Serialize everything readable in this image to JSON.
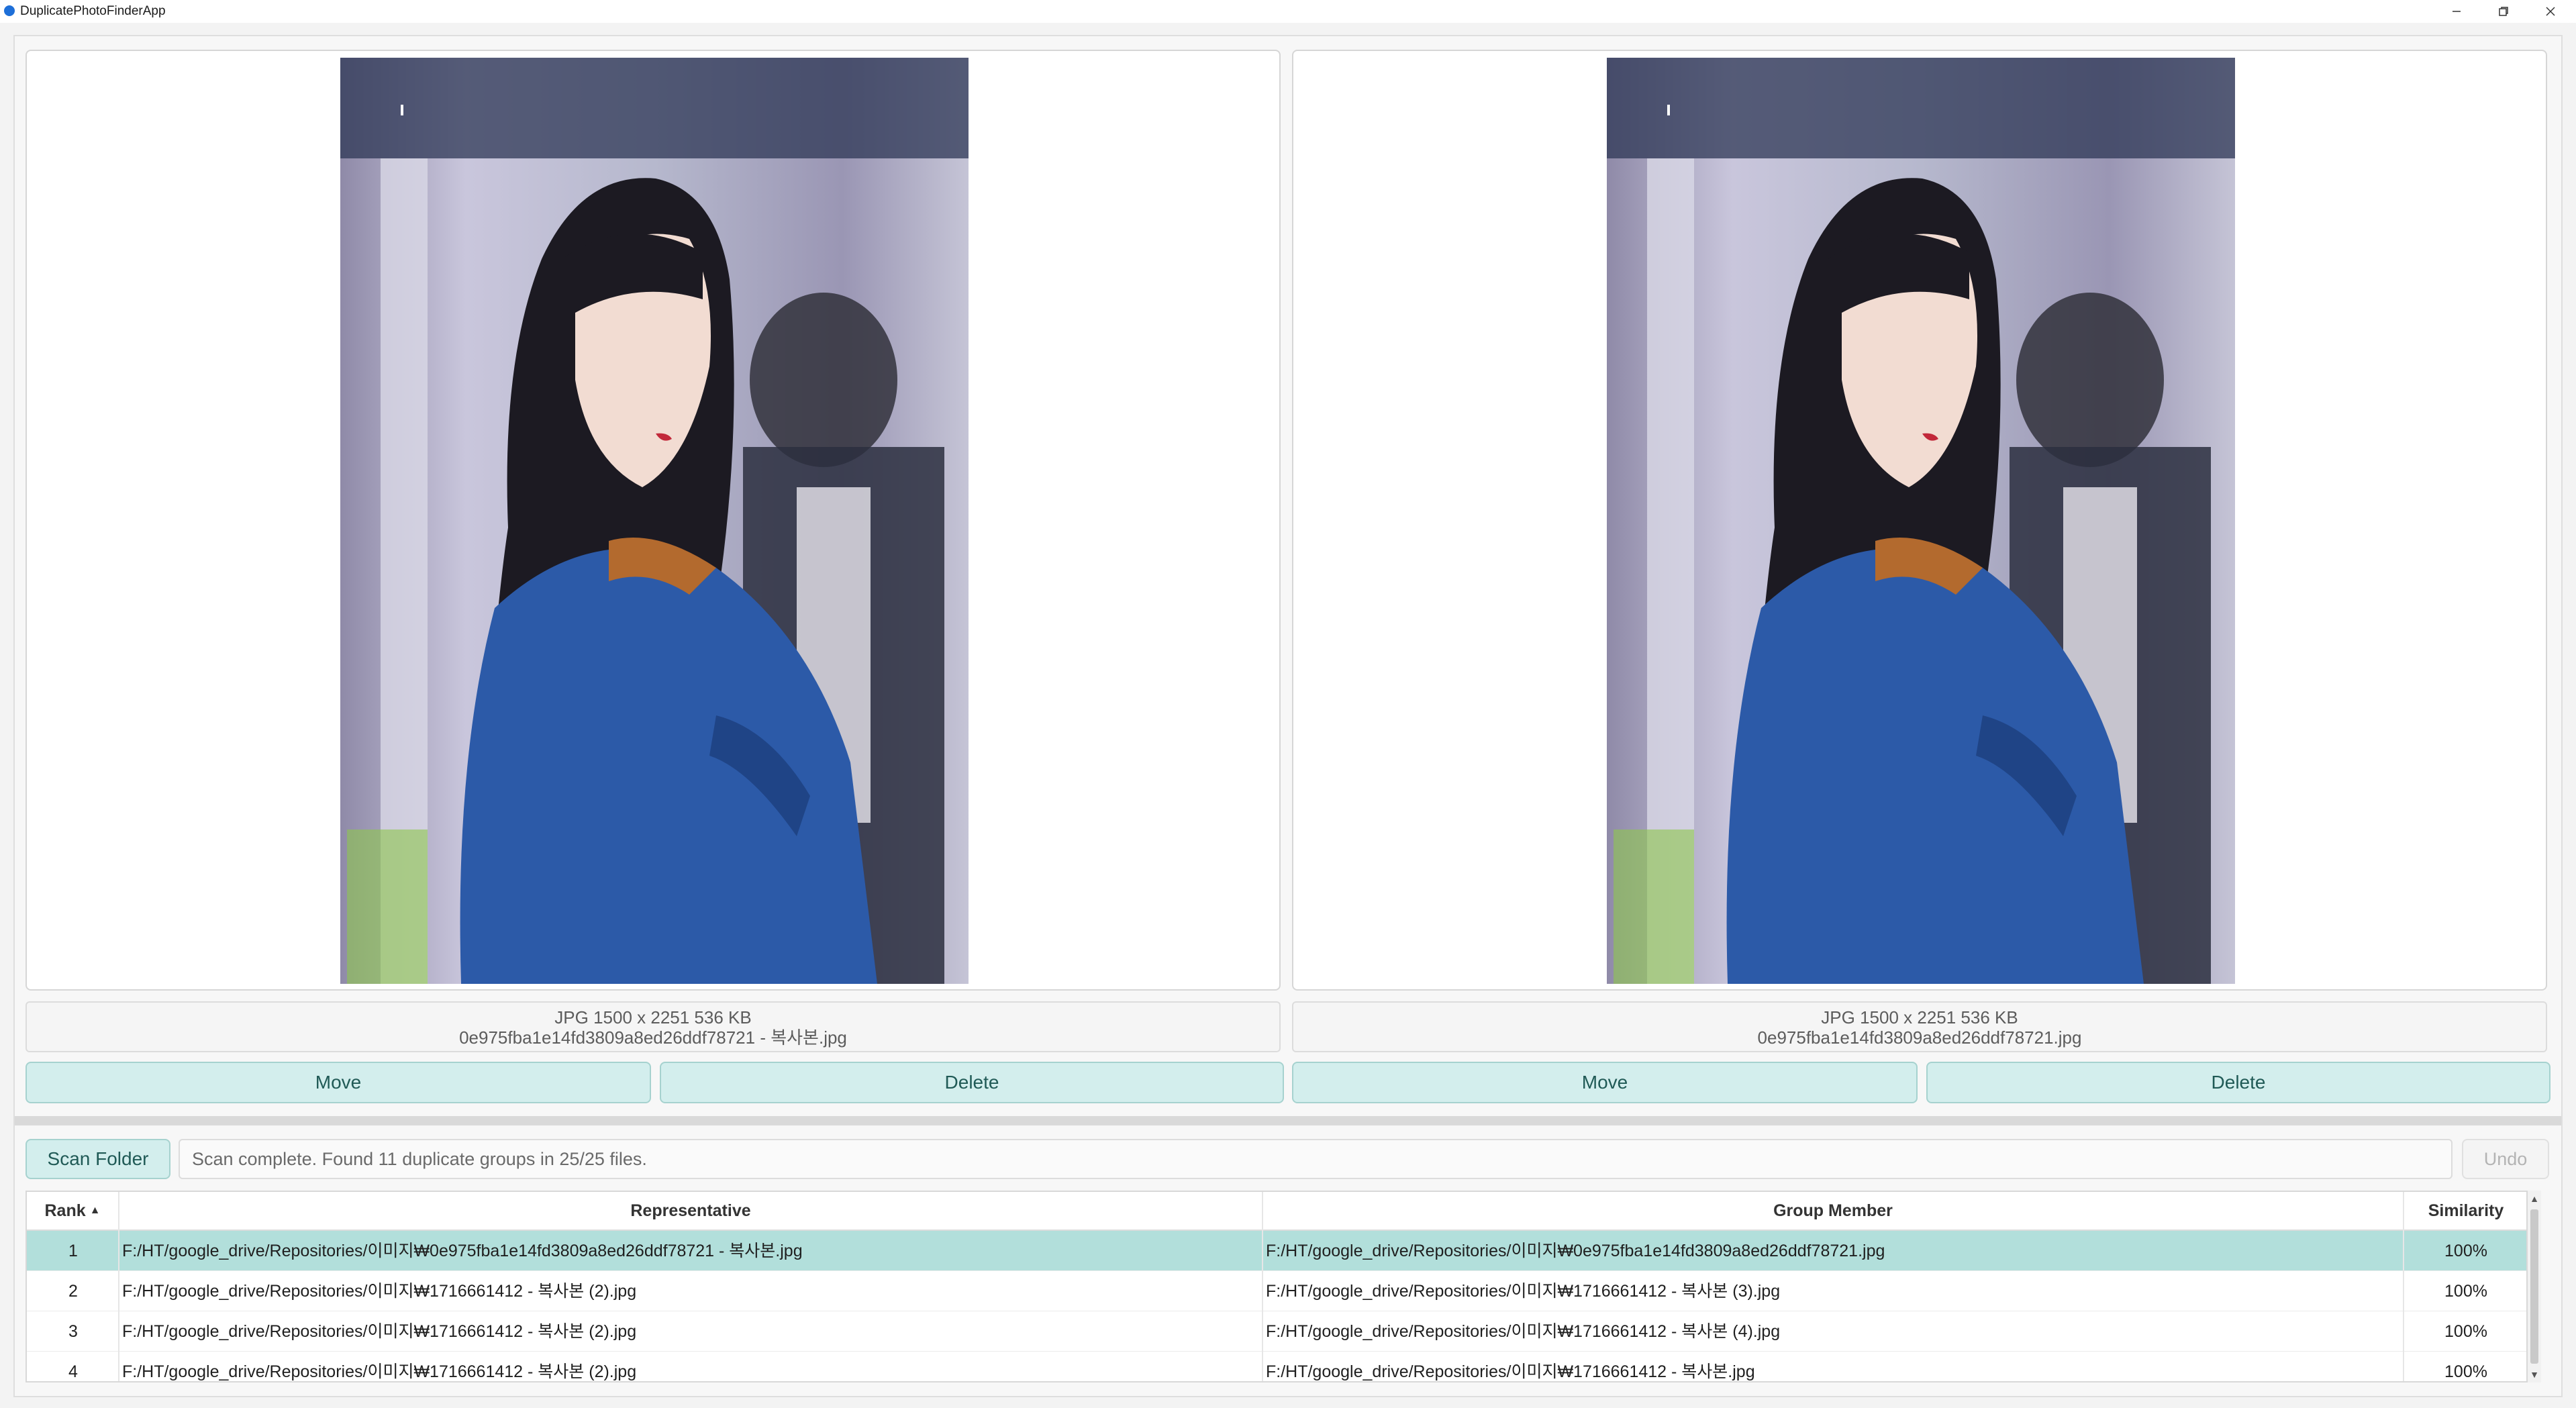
{
  "window": {
    "title": "DuplicatePhotoFinderApp"
  },
  "left": {
    "info_line1": "JPG 1500 x 2251 536 KB",
    "info_line2": "0e975fba1e14fd3809a8ed26ddf78721 - 복사본.jpg",
    "move_label": "Move",
    "delete_label": "Delete"
  },
  "right": {
    "info_line1": "JPG 1500 x 2251 536 KB",
    "info_line2": "0e975fba1e14fd3809a8ed26ddf78721.jpg",
    "move_label": "Move",
    "delete_label": "Delete"
  },
  "toolbar": {
    "scan_label": "Scan Folder",
    "status": "Scan complete. Found 11 duplicate groups in 25/25 files.",
    "undo_label": "Undo"
  },
  "table": {
    "headers": {
      "rank": "Rank",
      "representative": "Representative",
      "member": "Group Member",
      "similarity": "Similarity"
    },
    "sort_indicator": "▲",
    "rows": [
      {
        "rank": "1",
        "representative": "F:/HT/google_drive/Repositories/이미지₩0e975fba1e14fd3809a8ed26ddf78721 - 복사본.jpg",
        "member": "F:/HT/google_drive/Repositories/이미지₩0e975fba1e14fd3809a8ed26ddf78721.jpg",
        "similarity": "100%"
      },
      {
        "rank": "2",
        "representative": "F:/HT/google_drive/Repositories/이미지₩1716661412 - 복사본 (2).jpg",
        "member": "F:/HT/google_drive/Repositories/이미지₩1716661412 - 복사본 (3).jpg",
        "similarity": "100%"
      },
      {
        "rank": "3",
        "representative": "F:/HT/google_drive/Repositories/이미지₩1716661412 - 복사본 (2).jpg",
        "member": "F:/HT/google_drive/Repositories/이미지₩1716661412 - 복사본 (4).jpg",
        "similarity": "100%"
      },
      {
        "rank": "4",
        "representative": "F:/HT/google_drive/Repositories/이미지₩1716661412 - 복사본 (2).jpg",
        "member": "F:/HT/google_drive/Repositories/이미지₩1716661412 - 복사본.jpg",
        "similarity": "100%"
      }
    ]
  },
  "colors": {
    "accent": "#d3eeed",
    "accent_border": "#a6d2cf",
    "selected_row": "#b2dfdb"
  }
}
